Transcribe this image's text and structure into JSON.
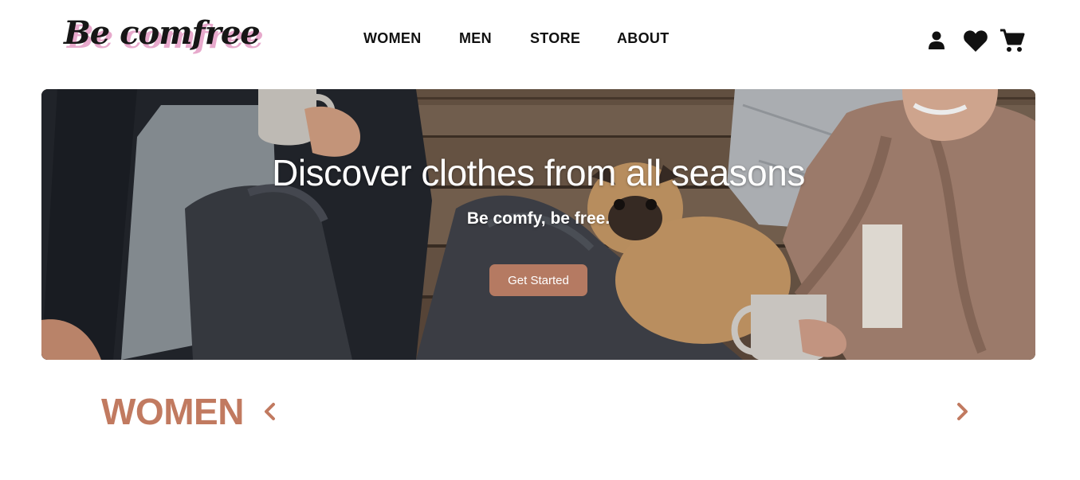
{
  "brand": {
    "logo_text": "Be comfree"
  },
  "nav": {
    "items": [
      {
        "label": "WOMEN"
      },
      {
        "label": "MEN"
      },
      {
        "label": "STORE"
      },
      {
        "label": "ABOUT"
      }
    ]
  },
  "header_icons": [
    "user-icon",
    "heart-icon",
    "cart-icon"
  ],
  "hero": {
    "title": "Discover clothes from all seasons",
    "subtitle": "Be comfy, be free.",
    "cta_label": "Get Started"
  },
  "section": {
    "title": "WOMEN",
    "prev_icon": "chevron-left-icon",
    "next_icon": "chevron-right-icon"
  },
  "colors": {
    "accent": "#c17a60",
    "button": "#b57a62",
    "logo_shadow": "#e7a9cc",
    "text": "#111111"
  }
}
